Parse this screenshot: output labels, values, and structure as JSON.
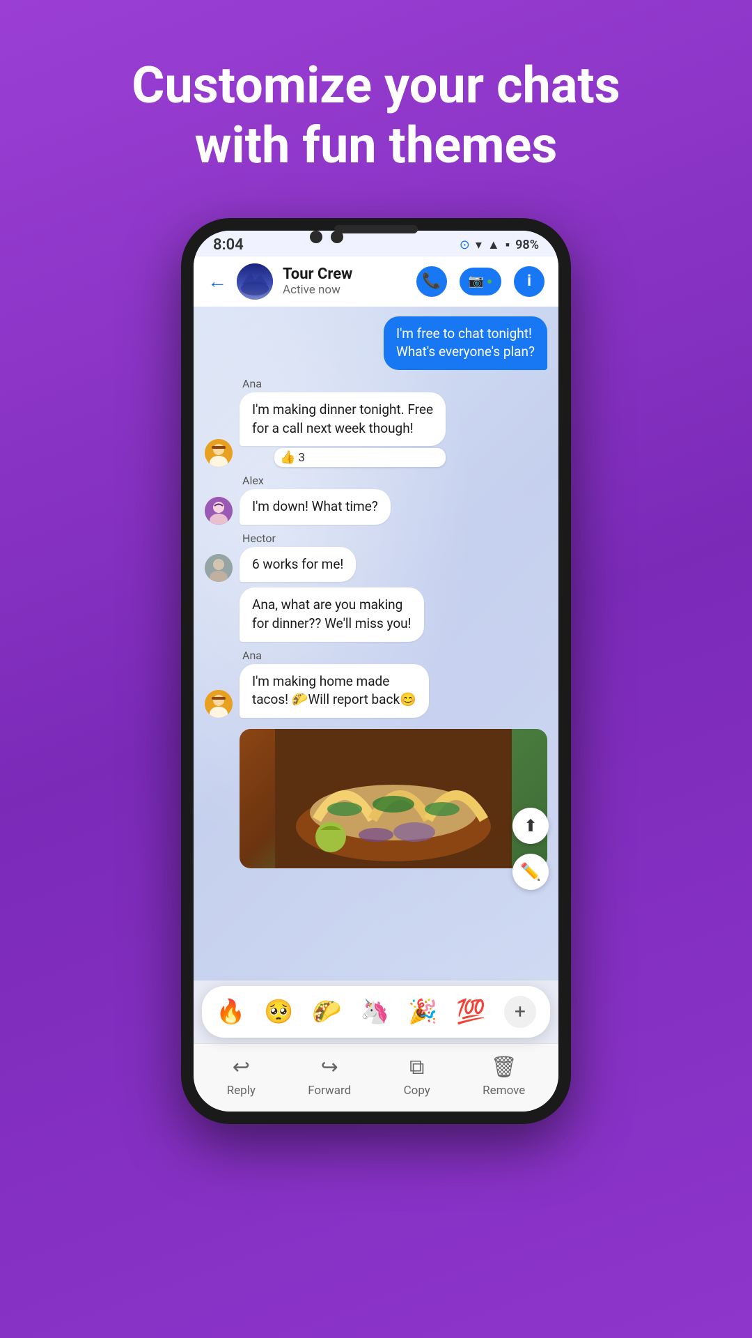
{
  "headline": {
    "line1": "Customize your chats",
    "line2": "with fun themes"
  },
  "status_bar": {
    "time": "8:04",
    "battery": "98%"
  },
  "chat_header": {
    "group_name": "Tour Crew",
    "status": "Active now",
    "back_label": "←"
  },
  "messages": [
    {
      "id": "msg1",
      "type": "mine",
      "text": "I'm free to chat tonight! What's everyone's plan?"
    },
    {
      "id": "msg2",
      "type": "other",
      "sender": "Ana",
      "avatar_emoji": "👩",
      "text": "I'm making dinner tonight. Free for a call next week though!",
      "reaction": "👍",
      "reaction_count": "3"
    },
    {
      "id": "msg3",
      "type": "other",
      "sender": "Alex",
      "avatar_emoji": "👩‍🦱",
      "text": "I'm down! What time?"
    },
    {
      "id": "msg4",
      "type": "other",
      "sender": "Hector",
      "avatar_emoji": "👨‍🦳",
      "text1": "6 works for me!",
      "text2": "Ana, what are you making for dinner?? We'll miss you!"
    },
    {
      "id": "msg5",
      "type": "other",
      "sender": "Ana",
      "text": "I'm making home made tacos! 🌮Will report back😊"
    }
  ],
  "emoji_bar": {
    "emojis": [
      "🔥",
      "🥺",
      "🌮",
      "🦄",
      "🎉",
      "💯"
    ],
    "plus_label": "+"
  },
  "action_buttons": {
    "share_icon": "⬆",
    "edit_icon": "✏"
  },
  "bottom_bar": {
    "actions": [
      {
        "id": "reply",
        "icon": "↩",
        "label": "Reply"
      },
      {
        "id": "forward",
        "icon": "↪",
        "label": "Forward"
      },
      {
        "id": "copy",
        "icon": "⧉",
        "label": "Copy"
      },
      {
        "id": "remove",
        "icon": "🗑",
        "label": "Remove"
      }
    ]
  }
}
